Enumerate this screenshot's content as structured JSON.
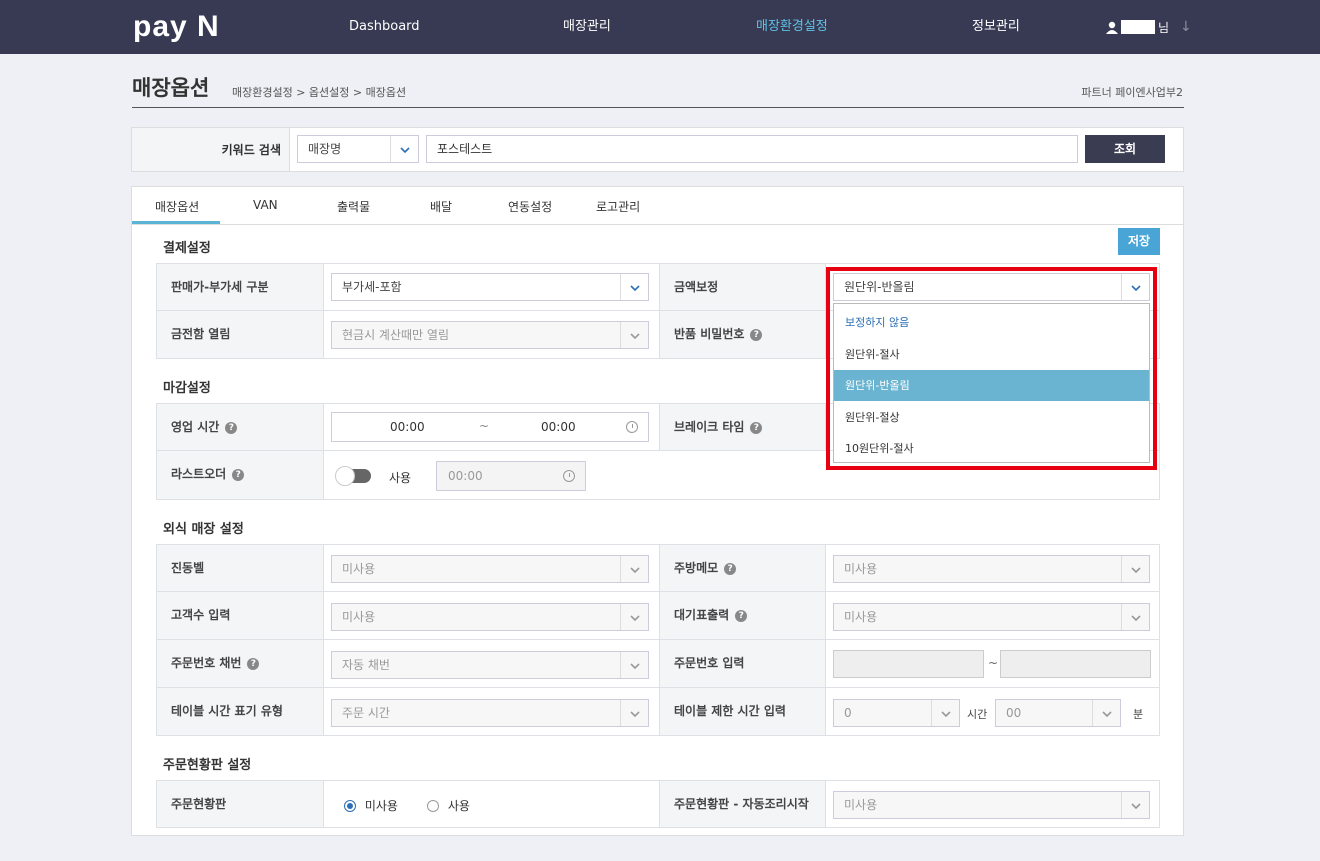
{
  "header": {
    "logo": "pay N",
    "nav": [
      "Dashboard",
      "매장관리",
      "매장환경설정",
      "정보관리"
    ],
    "active_nav": "매장환경설정",
    "user_suffix": "님",
    "user_menu_arrow": "↓"
  },
  "page": {
    "title": "매장옵션",
    "breadcrumb": "매장환경설정 > 옵션설정 > 매장옵션",
    "partner": "파트너 페이엔사업부2"
  },
  "search": {
    "label": "키워드 검색",
    "type_value": "매장명",
    "keyword_value": "포스테스트",
    "button": "조회"
  },
  "tabs": [
    "매장옵션",
    "VAN",
    "출력물",
    "배달",
    "연동설정",
    "로고관리"
  ],
  "save_label": "저장",
  "sections": {
    "payment": "결제설정",
    "closing": "마감설정",
    "dinein": "외식 매장 설정",
    "status_board": "주문현황판 설정"
  },
  "payment": {
    "vat_label": "판매가-부가세 구분",
    "vat_value": "부가세-포함",
    "amount_label": "금액보정",
    "amount_value": "원단위-반올림",
    "drawer_label": "금전함 열림",
    "drawer_value": "현금시 계산때만 열림",
    "refund_label": "반품 비밀번호"
  },
  "amount_dropdown": {
    "options": [
      "보정하지 않음",
      "원단위-절사",
      "원단위-반올림",
      "원단위-절상",
      "10원단위-절사"
    ],
    "selected": "원단위-반올림"
  },
  "closing": {
    "hours_label": "영업 시간",
    "hours_start": "00:00",
    "hours_sep": "~",
    "hours_end": "00:00",
    "break_label": "브레이크 타임",
    "lastorder_label": "라스트오더",
    "lastorder_toggle_label": "사용",
    "lastorder_time": "00:00"
  },
  "dinein": {
    "bell_label": "진동벨",
    "bell_value": "미사용",
    "kitchen_label": "주방메모",
    "kitchen_value": "미사용",
    "guests_label": "고객수 입력",
    "guests_value": "미사용",
    "waiting_label": "대기표출력",
    "waiting_value": "미사용",
    "ordernum_label": "주문번호 채번",
    "ordernum_value": "자동 채번",
    "ordernum_input_label": "주문번호 입력",
    "ordernum_sep": "~",
    "table_time_label": "테이블 시간 표기 유형",
    "table_time_value": "주문 시간",
    "table_limit_label": "테이블 제한 시간 입력",
    "table_limit_hours": "0",
    "table_limit_hours_unit": "시간",
    "table_limit_mins": "00",
    "table_limit_mins_unit": "분"
  },
  "status_board": {
    "board_label": "주문현황판",
    "opt_unused": "미사용",
    "opt_used": "사용",
    "selected": "미사용",
    "auto_label": "주문현황판 - 자동조리시작",
    "auto_value": "미사용"
  },
  "question_mark": "?",
  "dropdown_arrow": "⌄",
  "colors": {
    "topbar": "#373a52",
    "active_nav": "#5fc2e8",
    "save_button": "#49a5d6",
    "highlight_option": "#6ab4d1",
    "annotation_box": "#e60012"
  }
}
